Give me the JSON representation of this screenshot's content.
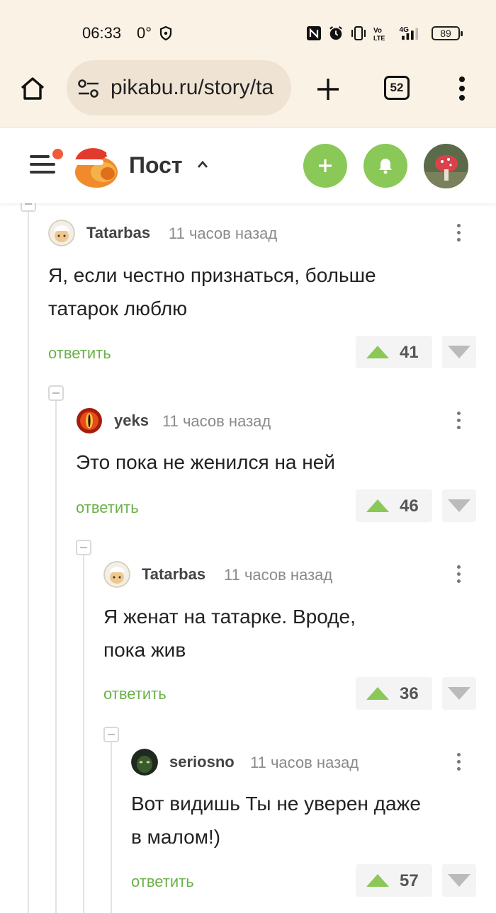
{
  "status_bar": {
    "time": "06:33",
    "temperature": "0°",
    "battery": "89",
    "icons": [
      "shield-icon",
      "nfc-icon",
      "alarm-icon",
      "vibrate-icon",
      "volte-icon",
      "signal-4g-icon",
      "battery-icon"
    ]
  },
  "browser": {
    "url": "pikabu.ru/story/ta",
    "tab_count": "52",
    "icons": [
      "home-icon",
      "site-settings-icon",
      "new-tab-icon",
      "tabs-icon",
      "more-vert-icon"
    ]
  },
  "header": {
    "title": "Пост",
    "colors": {
      "accent_green": "#8ac858",
      "notification_dot": "#f05a3c"
    },
    "icons": [
      "menu-icon",
      "pikabu-logo",
      "chevron-up-icon",
      "plus-icon",
      "bell-icon",
      "avatar"
    ]
  },
  "comments": [
    {
      "author": "Tatarbas",
      "time": "11 часов назад",
      "lines": [
        "Я, если честно признаться, больше",
        "татарок люблю"
      ],
      "reply": "ответить",
      "rating": "41"
    },
    {
      "author": "yeks",
      "time": "11 часов назад",
      "lines": [
        "Это пока не женился на ней"
      ],
      "reply": "ответить",
      "rating": "46"
    },
    {
      "author": "Tatarbas",
      "time": "11 часов назад",
      "lines": [
        "Я женат на татарке. Вроде,",
        "пока жив"
      ],
      "reply": "ответить",
      "rating": "36"
    },
    {
      "author": "seriosno",
      "time": "11 часов назад",
      "lines": [
        "Вот видишь Ты не уверен даже",
        "в малом!)"
      ],
      "reply": "ответить",
      "rating": "57"
    }
  ]
}
